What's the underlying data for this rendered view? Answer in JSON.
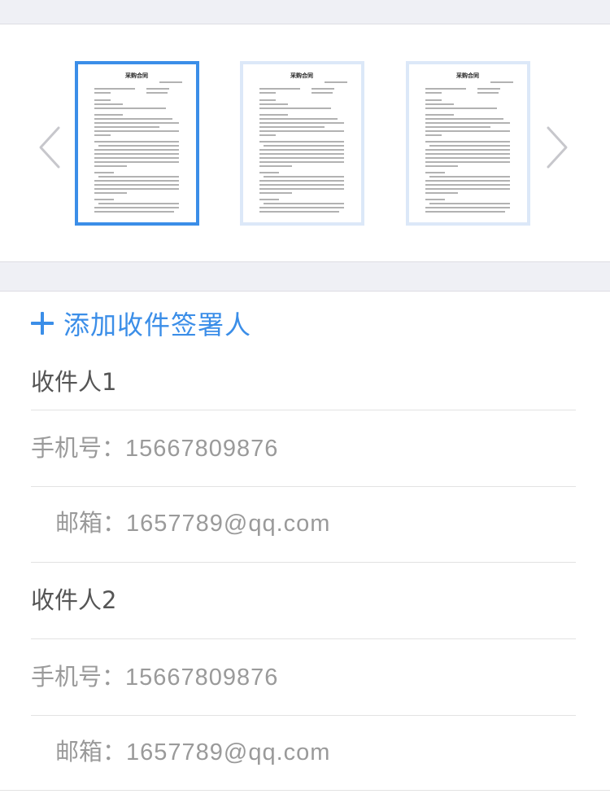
{
  "carousel": {
    "pages": [
      {
        "selected": true,
        "doc_title": "采购合同"
      },
      {
        "selected": false,
        "doc_title": "采购合同"
      },
      {
        "selected": false,
        "doc_title": "采购合同"
      }
    ],
    "prev_icon": "chevron-left-icon",
    "next_icon": "chevron-right-icon"
  },
  "add_signer": {
    "icon": "plus-icon",
    "label": "添加收件签署人"
  },
  "recipients": [
    {
      "title": "收件人1",
      "phone_label": "手机号：",
      "phone": "15667809876",
      "email_label": "邮箱：",
      "email": "1657789@qq.com"
    },
    {
      "title": "收件人2",
      "phone_label": "手机号：",
      "phone": "15667809876",
      "email_label": "邮箱：",
      "email": "1657789@qq.com"
    }
  ],
  "colors": {
    "accent": "#3b8ee8",
    "thumb_border": "#dce8f8",
    "band": "#eff0f5"
  }
}
